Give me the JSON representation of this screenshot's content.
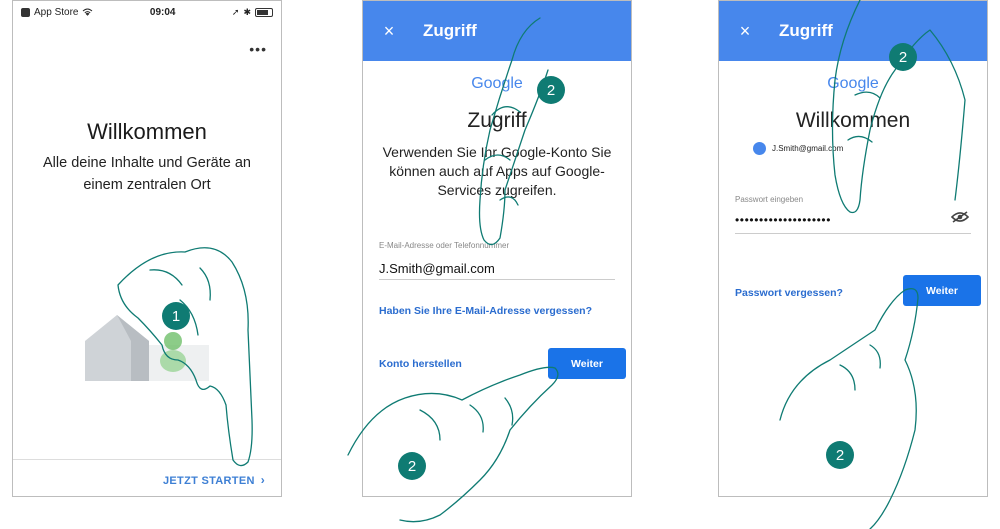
{
  "screen1": {
    "status": {
      "carrier": "App Store",
      "time": "09:04",
      "signal_icon": "wifi-icon"
    },
    "more_label": "•••",
    "title": "Willkommen",
    "subtitle": "Alle deine Inhalte und Geräte an einem zentralen Ort",
    "start_button": "JETZT STARTEN",
    "start_chevron": "›"
  },
  "screen2": {
    "close_label": "×",
    "header_title": "Zugriff",
    "logo_text": "Google",
    "heading": "Zugriff",
    "text": "Verwenden Sie Ihr Google-Konto Sie können auch auf Apps auf Google-Services zugreifen.",
    "email_label": "E-Mail-Adresse oder Telefonnummer",
    "email_value": "J.Smith@gmail.com",
    "forgot_link": "Haben Sie Ihre E-Mail-Adresse vergessen?",
    "create_link": "Konto herstellen",
    "next_button": "Weiter"
  },
  "screen3": {
    "close_label": "×",
    "header_title": "Zugriff",
    "logo_text": "Google",
    "heading": "Willkommen",
    "account": "J.Smith@gmail.com",
    "password_label": "Passwort eingeben",
    "password_value": "••••••••••••••••••••",
    "forgot_link": "Passwort vergessen?",
    "next_button": "Weiter"
  },
  "steps": {
    "step1": "1",
    "step2": "2"
  },
  "colors": {
    "accent": "#4787ec",
    "button": "#1a73e8",
    "badge": "#0f7b73",
    "hand_stroke": "#0f7b73"
  }
}
